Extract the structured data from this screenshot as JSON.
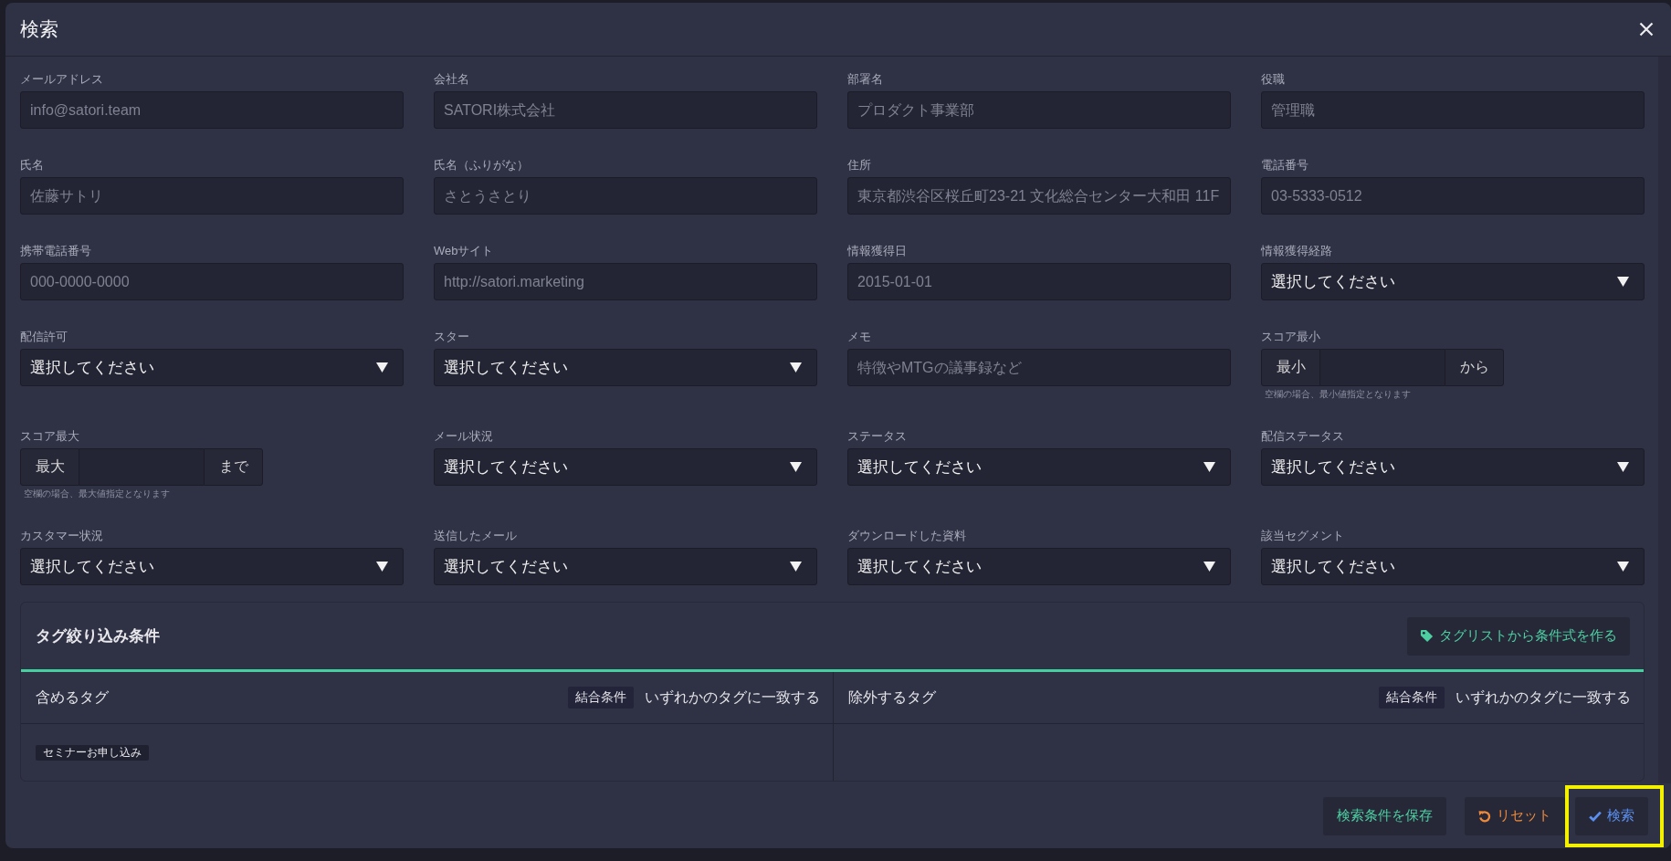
{
  "dialog": {
    "title": "検索"
  },
  "fields": [
    {
      "kind": "text",
      "label": "メールアドレス",
      "placeholder": "info@satori.team"
    },
    {
      "kind": "text",
      "label": "会社名",
      "placeholder": "SATORI株式会社"
    },
    {
      "kind": "text",
      "label": "部署名",
      "placeholder": "プロダクト事業部"
    },
    {
      "kind": "text",
      "label": "役職",
      "placeholder": "管理職"
    },
    {
      "kind": "text",
      "label": "氏名",
      "placeholder": "佐藤サトリ"
    },
    {
      "kind": "text",
      "label": "氏名（ふりがな）",
      "placeholder": "さとうさとり"
    },
    {
      "kind": "text",
      "label": "住所",
      "placeholder": "東京都渋谷区桜丘町23-21 文化総合センター大和田 11F"
    },
    {
      "kind": "text",
      "label": "電話番号",
      "placeholder": "03-5333-0512"
    },
    {
      "kind": "text",
      "label": "携帯電話番号",
      "placeholder": "000-0000-0000"
    },
    {
      "kind": "text",
      "label": "Webサイト",
      "placeholder": "http://satori.marketing"
    },
    {
      "kind": "text",
      "label": "情報獲得日",
      "placeholder": "2015-01-01"
    },
    {
      "kind": "select",
      "label": "情報獲得経路",
      "value": "選択してください"
    },
    {
      "kind": "select",
      "label": "配信許可",
      "value": "選択してください"
    },
    {
      "kind": "select",
      "label": "スター",
      "value": "選択してください"
    },
    {
      "kind": "text",
      "label": "メモ",
      "placeholder": "特徴やMTGの議事録など"
    },
    {
      "kind": "range",
      "label": "スコア最小",
      "prefix": "最小",
      "suffix": "から",
      "hint": "空欄の場合、最小値指定となります"
    },
    {
      "kind": "range",
      "label": "スコア最大",
      "prefix": "最大",
      "suffix": "まで",
      "hint": "空欄の場合、最大値指定となります"
    },
    {
      "kind": "select",
      "label": "メール状況",
      "value": "選択してください"
    },
    {
      "kind": "select",
      "label": "ステータス",
      "value": "選択してください"
    },
    {
      "kind": "select",
      "label": "配信ステータス",
      "value": "選択してください"
    },
    {
      "kind": "select",
      "label": "カスタマー状況",
      "value": "選択してください"
    },
    {
      "kind": "select",
      "label": "送信したメール",
      "value": "選択してください"
    },
    {
      "kind": "select",
      "label": "ダウンロードした資料",
      "value": "選択してください"
    },
    {
      "kind": "select",
      "label": "該当セグメント",
      "value": "選択してください"
    }
  ],
  "tag_filter": {
    "title": "タグ絞り込み条件",
    "builder_button": "タグリストから条件式を作る",
    "groups": [
      {
        "title": "含めるタグ",
        "condition_label": "結合条件",
        "condition": "いずれかのタグに一致する",
        "tags": [
          "セミナーお申し込み"
        ]
      },
      {
        "title": "除外するタグ",
        "condition_label": "結合条件",
        "condition": "いずれかのタグに一致する"
      }
    ]
  },
  "footer": {
    "buttons": [
      {
        "kind": "save",
        "label": "検索条件を保存",
        "highlighted": false
      },
      {
        "kind": "reset",
        "label": "リセット",
        "highlighted": false
      },
      {
        "kind": "search",
        "label": "検索",
        "highlighted": true
      }
    ]
  }
}
